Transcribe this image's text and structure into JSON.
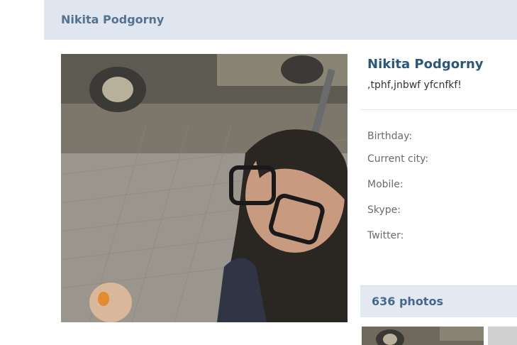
{
  "header": {
    "name": "Nikita Podgorny"
  },
  "profile": {
    "name": "Nikita Podgorny",
    "status": ",tphf,jnbwf yfcnfkf!",
    "fields": [
      {
        "label": "Birthday:"
      },
      {
        "label": "Current city:"
      },
      {
        "label": "Mobile:"
      },
      {
        "label": "Skype:"
      },
      {
        "label": "Twitter:"
      }
    ]
  },
  "photos": {
    "label": "636 photos"
  },
  "colors": {
    "header_bg": "#dfe6ef",
    "name_link": "#2b587a",
    "section_bg": "#e3e9f1"
  }
}
